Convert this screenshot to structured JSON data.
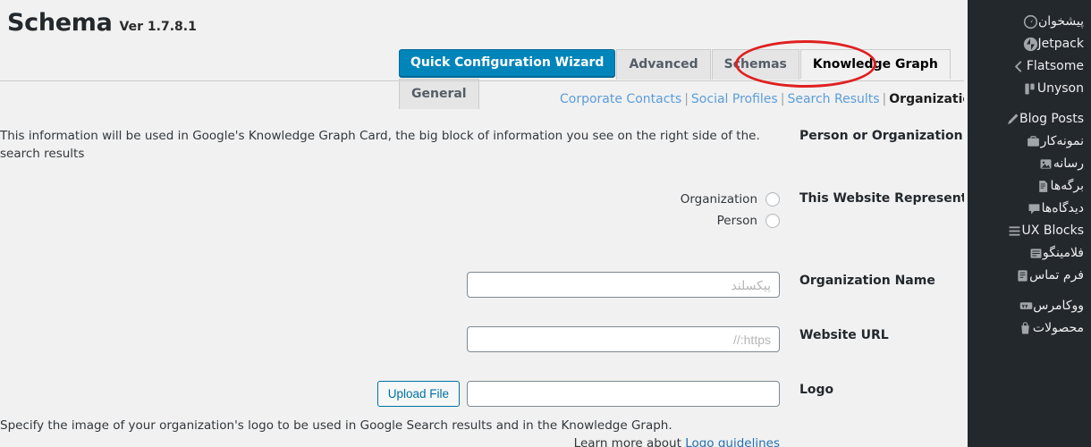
{
  "plugin": {
    "title": "Schema",
    "version": "Ver 1.7.8.1"
  },
  "tabs": [
    {
      "label": "Quick Configuration Wizard",
      "style": "primary",
      "active": false
    },
    {
      "label": "Advanced",
      "style": "tab",
      "active": false
    },
    {
      "label": "Schemas",
      "style": "tab",
      "active": false
    },
    {
      "label": "Knowledge Graph",
      "style": "tab",
      "active": true
    },
    {
      "label": "General",
      "style": "tab",
      "active": false
    }
  ],
  "subnav": {
    "items": [
      {
        "label": "Corporate Contacts",
        "current": false
      },
      {
        "label": "Social Profiles",
        "current": false
      },
      {
        "label": "Search Results",
        "current": false
      },
      {
        "label": "Organization Info",
        "current": true
      }
    ],
    "separator": "|"
  },
  "form": {
    "person_or_organization": {
      "label": "Person or Organization",
      "description": ".This information will be used in Google's Knowledge Graph Card, the big block of information you see on the right side of the search results"
    },
    "website_represent": {
      "label": "This Website Represent",
      "options": [
        {
          "label": "Organization",
          "checked": false
        },
        {
          "label": "Person",
          "checked": false
        }
      ]
    },
    "organization_name": {
      "label": "Organization Name",
      "value": "",
      "placeholder": "پیکسلند"
    },
    "website_url": {
      "label": "Website URL",
      "value": "",
      "placeholder": "https://"
    },
    "logo": {
      "label": "Logo",
      "upload_button": "Upload File",
      "value": "",
      "placeholder": "",
      "help_line1": ".Specify the image of your organization's logo to be used in Google Search results and in the Knowledge Graph",
      "help_line2_prefix": "Learn more about ",
      "help_link": "Logo guidelines"
    }
  },
  "sidebar": {
    "items": [
      {
        "label": "پیشخوان",
        "icon": "dashboard-icon"
      },
      {
        "label": "Jetpack",
        "icon": "jetpack-icon"
      },
      {
        "label": "Flatsome",
        "icon": "flatsome-icon"
      },
      {
        "label": "Unyson",
        "icon": "unyson-icon"
      },
      {
        "label": "Blog Posts",
        "icon": "posts-icon"
      },
      {
        "label": "نمونه‌کار",
        "icon": "portfolio-icon"
      },
      {
        "label": "رسانه",
        "icon": "media-icon"
      },
      {
        "label": "برگه‌ها",
        "icon": "pages-icon"
      },
      {
        "label": "دیدگاه‌ها",
        "icon": "comments-icon"
      },
      {
        "label": "UX Blocks",
        "icon": "blocks-icon"
      },
      {
        "label": "فلامینگو",
        "icon": "flamingo-icon"
      },
      {
        "label": "فرم تماس",
        "icon": "contact-form-icon"
      },
      {
        "label": "ووکامرس",
        "icon": "woocommerce-icon"
      },
      {
        "label": "محصولات",
        "icon": "products-icon"
      }
    ]
  },
  "colors": {
    "primary_button": "#0085ba",
    "sidebar_bg": "#23282d",
    "page_bg": "#f1f1f1",
    "link": "#5b9dd9",
    "annotation": "#e02020",
    "upload_border": "#0071a1"
  }
}
